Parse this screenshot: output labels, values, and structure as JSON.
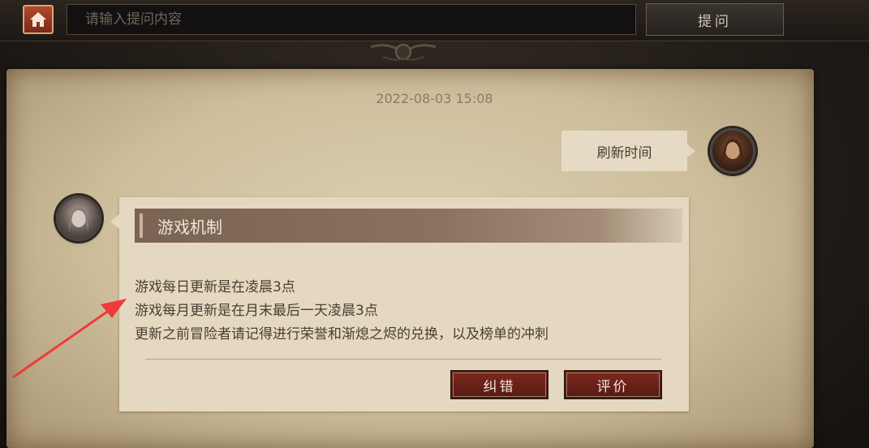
{
  "topbar": {
    "home_icon": "home-icon",
    "search_placeholder": "请输入提问内容",
    "ask_label": "提问"
  },
  "chat": {
    "timestamp": "2022-08-03 15:08",
    "user_message": "刷新时间",
    "answer": {
      "title": "游戏机制",
      "lines": [
        "游戏每日更新是在凌晨3点",
        "游戏每月更新是在月末最后一天凌晨3点",
        "更新之前冒险者请记得进行荣誉和渐熄之烬的兑换，以及榜单的冲刺"
      ],
      "correct_label": "纠错",
      "rate_label": "评价"
    }
  },
  "colors": {
    "accent_red": "#7c2a1f",
    "parchment": "#d6c8a8",
    "annotation_arrow": "#f03a3a"
  }
}
